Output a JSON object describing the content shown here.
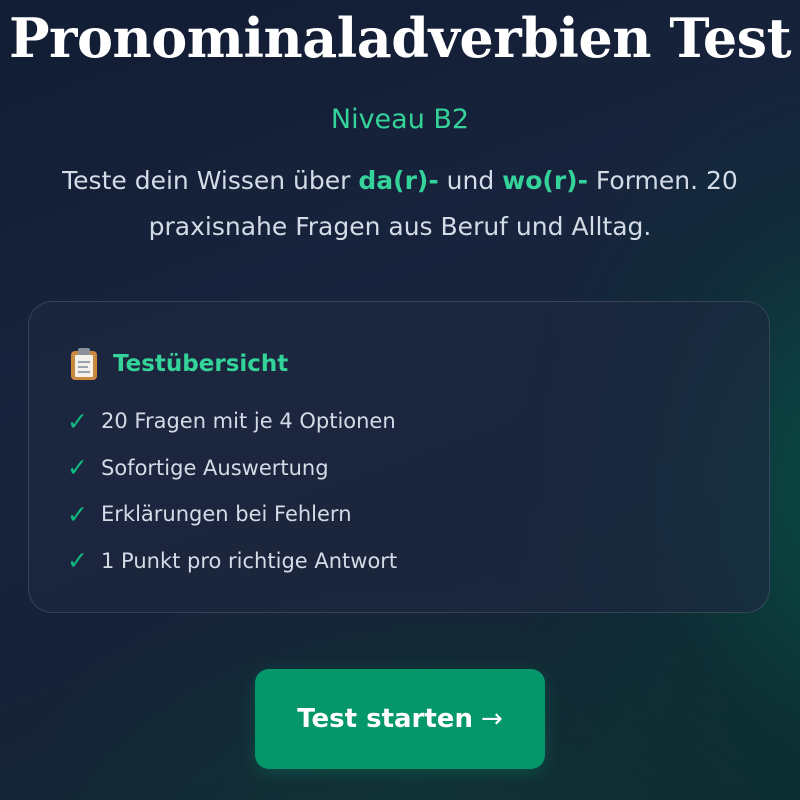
{
  "header": {
    "title": "Pronominaladverbien Test",
    "level": "Niveau B2"
  },
  "intro": {
    "prefix": "Teste dein Wissen über ",
    "highlight1": "da(r)-",
    "middle": " und ",
    "highlight2": "wo(r)-",
    "suffix": " Formen. 20 praxisnahe Fragen aus Beruf und Alltag."
  },
  "overview": {
    "icon": "clipboard-icon",
    "title": "Testübersicht",
    "check_icon": "check-icon",
    "items": [
      "20 Fragen mit je 4 Optionen",
      "Sofortige Auswertung",
      "Erklärungen bei Fehlern",
      "1 Punkt pro richtige Antwort"
    ]
  },
  "start_button": {
    "label": "Test starten",
    "icon": "arrow-right-icon"
  },
  "colors": {
    "accent": "#34d399",
    "button": "#059669",
    "background": "#18233d"
  }
}
